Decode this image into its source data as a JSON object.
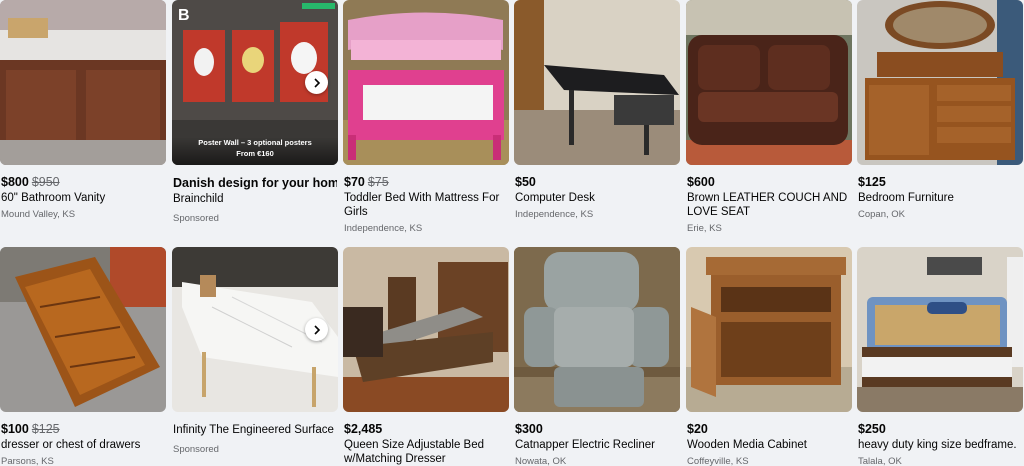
{
  "listings_row_1": [
    {
      "price": "$800",
      "old_price": "$950",
      "title": "60\" Bathroom Vanity",
      "location": "Mound Valley, KS"
    },
    {
      "title": "Danish design for your home...",
      "advertiser": "Brainchild",
      "sponsored_label": "Sponsored",
      "ad_caption_line_1": "Poster Wall – 3 optional posters",
      "ad_caption_line_2": "From €160",
      "logo_text": "B",
      "icon": "chevron-right-icon"
    },
    {
      "price": "$70",
      "old_price": "$75",
      "title": "Toddler Bed With Mattress For Girls",
      "location": "Independence, KS"
    },
    {
      "price": "$50",
      "title": "Computer Desk",
      "location": "Independence, KS"
    },
    {
      "price": "$600",
      "title": "Brown LEATHER COUCH AND LOVE SEAT",
      "location": "Erie, KS"
    },
    {
      "price": "$125",
      "title": "Bedroom Furniture",
      "location": "Copan, OK"
    }
  ],
  "listings_row_2": [
    {
      "price": "$100",
      "old_price": "$125",
      "title": "dresser or chest of drawers",
      "location": "Parsons, KS"
    },
    {
      "title": "Infinity The Engineered Surface",
      "sponsored_label": "Sponsored",
      "icon": "chevron-right-icon"
    },
    {
      "price": "$2,485",
      "title": "Queen Size Adjustable Bed w/Matching Dresser"
    },
    {
      "price": "$300",
      "title": "Catnapper Electric Recliner",
      "location": "Nowata, OK"
    },
    {
      "price": "$20",
      "title": "Wooden Media Cabinet",
      "location": "Coffeyville, KS"
    },
    {
      "price": "$250",
      "title": "heavy duty king size bedframe.",
      "location": "Talala, OK"
    }
  ],
  "colors": {
    "page_background": "#f0f2f5",
    "primary_text": "#050505",
    "secondary_text": "#65676b",
    "rating_badge": "#27b86b"
  }
}
